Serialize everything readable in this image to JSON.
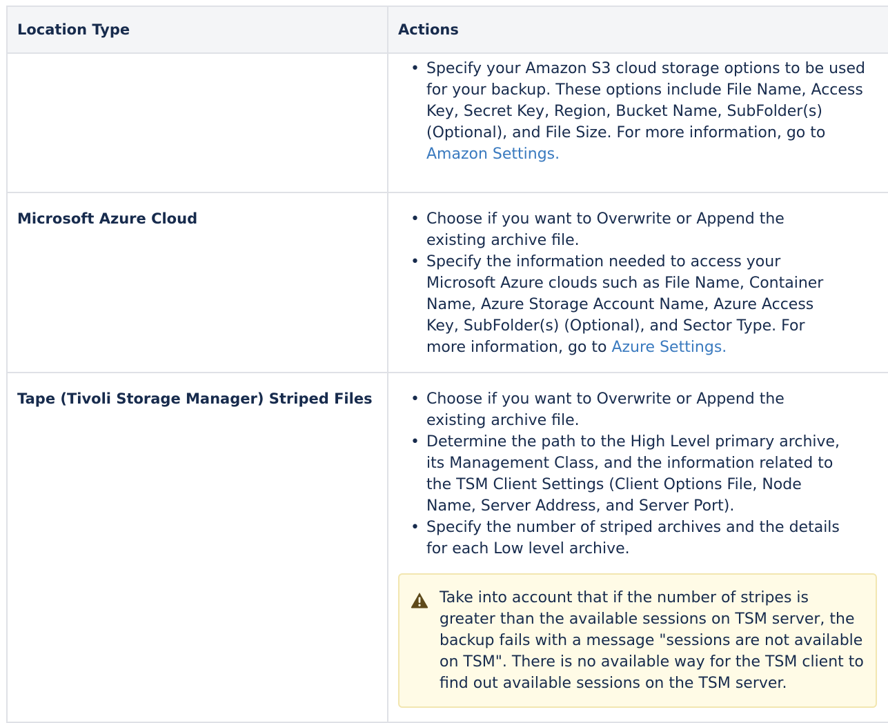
{
  "table": {
    "headers": {
      "location_type": "Location Type",
      "actions": "Actions"
    },
    "rows": [
      {
        "location_type": "",
        "actions": [
          {
            "text": "Specify your Amazon S3 cloud storage options to be used for your backup. These options include File Name, Access Key, Secret Key, Region, Bucket Name, SubFolder(s) (Optional), and File Size. For more information, go to ",
            "link": "Amazon Settings."
          }
        ]
      },
      {
        "location_type": "Microsoft Azure Cloud",
        "actions": [
          {
            "text": "Choose if you want to Overwrite or Append the existing archive file."
          },
          {
            "text": "Specify the information needed to access your Microsoft Azure clouds such as File Name, Container Name, Azure Storage Account Name, Azure Access Key, SubFolder(s) (Optional), and Sector Type. For more information, go to ",
            "link": "Azure Settings."
          }
        ]
      },
      {
        "location_type": "Tape (Tivoli Storage Manager) Striped Files",
        "actions": [
          {
            "text": "Choose if you want to Overwrite or Append the existing archive file."
          },
          {
            "text": "Determine the path to the High Level primary archive, its Management Class, and the information related to the TSM Client Settings (Client Options File, Node Name, Server Address, and Server Port)."
          },
          {
            "text": "Specify the number of striped archives and the details for each Low level archive."
          }
        ],
        "warning": {
          "icon": "warning-icon",
          "text": "Take into account that if the number of stripes is greater than the available sessions on TSM server, the backup fails with a message \"sessions are not available on TSM\". There is no available way for the TSM client to find out available sessions on the TSM server."
        }
      }
    ]
  },
  "colors": {
    "link": "#3a7abf",
    "header_bg": "#f4f5f7",
    "border": "#dfe1e6",
    "warning_bg": "#fffbe6",
    "warning_border": "#f2e6b0",
    "warning_icon": "#5e4a1a"
  }
}
